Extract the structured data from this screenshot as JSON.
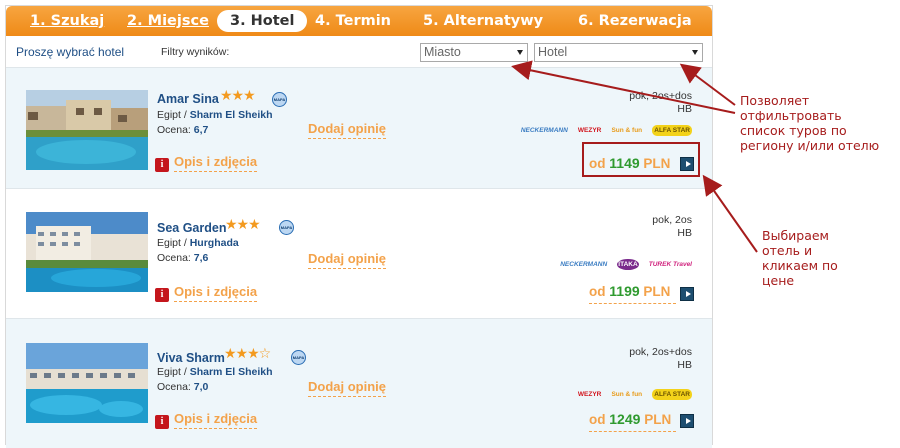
{
  "steps": [
    {
      "label": "1. Szukaj",
      "state": "done"
    },
    {
      "label": "2. Miejsce",
      "state": "done"
    },
    {
      "label": "3. Hotel",
      "state": "active"
    },
    {
      "label": "4. Termin",
      "state": "todo"
    },
    {
      "label": "5. Alternatywy",
      "state": "todo"
    },
    {
      "label": "6. Rezerwacja",
      "state": "todo"
    }
  ],
  "filterbar": {
    "choose_label": "Proszę wybrać hotel",
    "filters_label": "Filtry wyników:",
    "city_select": "Miasto",
    "hotel_select": "Hotel"
  },
  "hotels": [
    {
      "name": "Amar Sina",
      "stars": "★★★",
      "map_label": "MAPA",
      "country": "Egipt",
      "city": "Sharm El Sheikh",
      "rating_label": "Ocena:",
      "rating": "6,7",
      "opinion": "Dodaj opinię",
      "info_icon": "i",
      "desc": "Opis i zdjęcia",
      "room": "pok, 2os+dos",
      "board": "HB",
      "operators": [
        "NECKERMANN",
        "WEZYR",
        "Sun & fun",
        "ALFA STAR"
      ],
      "price_prefix": "od",
      "price": "1149",
      "currency": "PLN"
    },
    {
      "name": "Sea Garden",
      "stars": "★★★",
      "map_label": "MAPA",
      "country": "Egipt",
      "city": "Hurghada",
      "rating_label": "Ocena:",
      "rating": "7,6",
      "opinion": "Dodaj opinię",
      "info_icon": "i",
      "desc": "Opis i zdjęcia",
      "room": "pok, 2os",
      "board": "HB",
      "operators": [
        "NECKERMANN",
        "ITAKA",
        "TUREK Travel"
      ],
      "price_prefix": "od",
      "price": "1199",
      "currency": "PLN"
    },
    {
      "name": "Viva Sharm",
      "stars": "★★★☆",
      "map_label": "MAPA",
      "country": "Egipt",
      "city": "Sharm El Sheikh",
      "rating_label": "Ocena:",
      "rating": "7,0",
      "opinion": "Dodaj opinię",
      "info_icon": "i",
      "desc": "Opis i zdjęcia",
      "room": "pok, 2os+dos",
      "board": "HB",
      "operators": [
        "WEZYR",
        "Sun & fun",
        "ALFA STAR"
      ],
      "price_prefix": "od",
      "price": "1249",
      "currency": "PLN"
    }
  ],
  "notes": {
    "filter": "Позволяет\nотфильтровать\nсписок туров по\nрегиону и/или отелю",
    "price": "Выбираем\nотель и\nкликаем по\nцене"
  },
  "colors": {
    "accent_orange": "#ef8a17",
    "link_blue": "#1f4f85",
    "price_green": "#2f9a2f",
    "annotation_red": "#a61c1c"
  }
}
